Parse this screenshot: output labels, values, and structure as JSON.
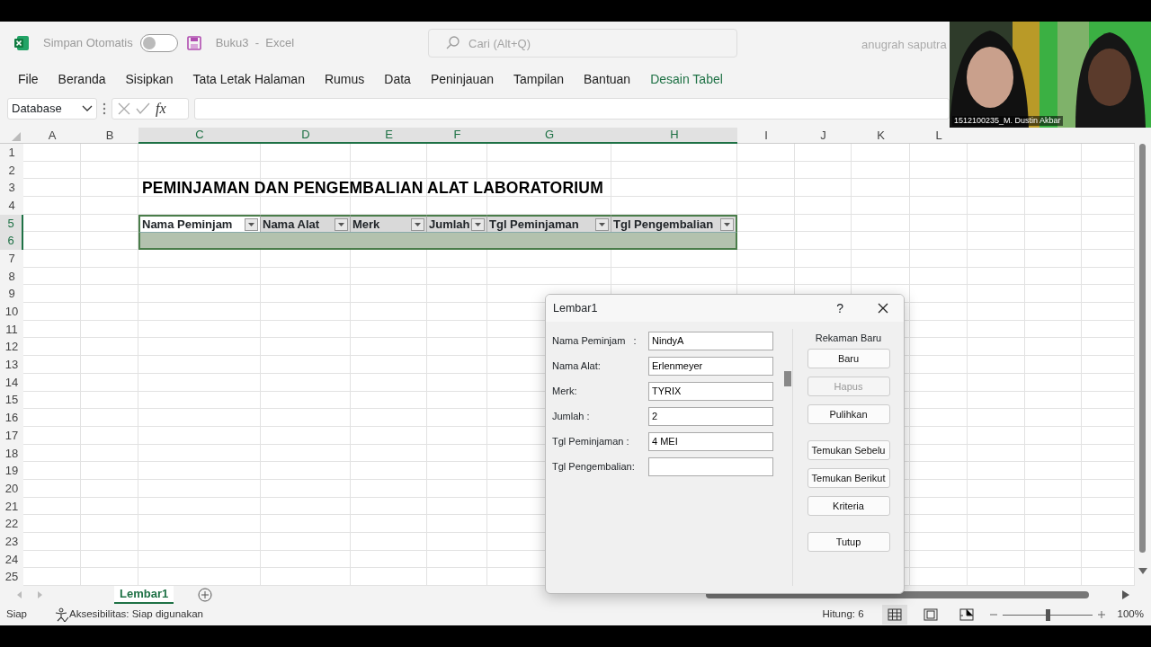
{
  "titlebar": {
    "autosave_label": "Simpan Otomatis",
    "autosave_on": false,
    "document": "Buku3",
    "separator": "-",
    "app": "Excel",
    "search": {
      "placeholder": "Cari (Alt+Q)"
    },
    "user": "anugrah saputra"
  },
  "ribbon_tabs": [
    {
      "label": "File",
      "kind": "standard"
    },
    {
      "label": "Beranda",
      "kind": "standard"
    },
    {
      "label": "Sisipkan",
      "kind": "standard"
    },
    {
      "label": "Tata Letak Halaman",
      "kind": "standard"
    },
    {
      "label": "Rumus",
      "kind": "standard"
    },
    {
      "label": "Data",
      "kind": "standard"
    },
    {
      "label": "Peninjauan",
      "kind": "standard"
    },
    {
      "label": "Tampilan",
      "kind": "standard"
    },
    {
      "label": "Bantuan",
      "kind": "standard"
    },
    {
      "label": "Desain Tabel",
      "kind": "contextual"
    }
  ],
  "formula_bar": {
    "name_box": "Database",
    "function_label": "fx"
  },
  "sheet": {
    "columns": [
      {
        "label": "A",
        "selected": false
      },
      {
        "label": "B",
        "selected": false
      },
      {
        "label": "C",
        "selected": true
      },
      {
        "label": "D",
        "selected": true
      },
      {
        "label": "E",
        "selected": true
      },
      {
        "label": "F",
        "selected": true
      },
      {
        "label": "G",
        "selected": true
      },
      {
        "label": "H",
        "selected": true
      },
      {
        "label": "I",
        "selected": false
      },
      {
        "label": "J",
        "selected": false
      },
      {
        "label": "K",
        "selected": false
      },
      {
        "label": "L",
        "selected": false
      }
    ],
    "rows": [
      {
        "label": "1",
        "selected": false
      },
      {
        "label": "2",
        "selected": false
      },
      {
        "label": "3",
        "selected": false
      },
      {
        "label": "4",
        "selected": false
      },
      {
        "label": "5",
        "selected": true
      },
      {
        "label": "6",
        "selected": true
      },
      {
        "label": "7",
        "selected": false
      },
      {
        "label": "8",
        "selected": false
      },
      {
        "label": "9",
        "selected": false
      },
      {
        "label": "10",
        "selected": false
      },
      {
        "label": "11",
        "selected": false
      },
      {
        "label": "12",
        "selected": false
      },
      {
        "label": "13",
        "selected": false
      },
      {
        "label": "14",
        "selected": false
      },
      {
        "label": "15",
        "selected": false
      },
      {
        "label": "16",
        "selected": false
      },
      {
        "label": "17",
        "selected": false
      },
      {
        "label": "18",
        "selected": false
      },
      {
        "label": "19",
        "selected": false
      },
      {
        "label": "20",
        "selected": false
      },
      {
        "label": "21",
        "selected": false
      },
      {
        "label": "22",
        "selected": false
      },
      {
        "label": "23",
        "selected": false
      },
      {
        "label": "24",
        "selected": false
      },
      {
        "label": "25",
        "selected": false
      }
    ],
    "title": "PEMINJAMAN DAN PENGEMBALIAN ALAT LABORATORIUM",
    "table": {
      "headers": [
        "Nama Peminjam",
        "Nama Alat",
        "Merk",
        "Jumlah",
        "Tgl Peminjaman",
        "Tgl Pengembalian"
      ]
    }
  },
  "video": {
    "caption": "1512100235_M. Dustin Akbar"
  },
  "dialog": {
    "title": "Lembar1",
    "help": "?",
    "fields": [
      {
        "label": "Nama Peminjam   :",
        "value": "NindyA"
      },
      {
        "label": "Nama Alat:",
        "value": "Erlenmeyer"
      },
      {
        "label": "Merk:",
        "value": "TYRIX"
      },
      {
        "label": "Jumlah :",
        "value": "2"
      },
      {
        "label": "Tgl Peminjaman :",
        "value": "4 MEI"
      },
      {
        "label": "Tgl Pengembalian:"
      }
    ],
    "record_status": "Rekaman Baru",
    "buttons": [
      {
        "label": "Baru",
        "disabled": false
      },
      {
        "label": "Hapus",
        "disabled": true
      },
      {
        "label": "Pulihkan",
        "disabled": false
      },
      {
        "label": "Temukan Sebelu",
        "disabled": false
      },
      {
        "label": "Temukan Berikut",
        "disabled": false
      },
      {
        "label": "Kriteria",
        "disabled": false
      },
      {
        "label": "Tutup",
        "disabled": false
      }
    ]
  },
  "sheet_tabs": [
    {
      "label": "Lembar1",
      "selected": true
    }
  ],
  "status_bar": {
    "mode": "Siap",
    "accessibility": "Aksesibilitas: Siap digunakan",
    "count": "Hitung: 6",
    "views": [
      {
        "kind": "normal",
        "selected": true
      },
      {
        "kind": "page_layout",
        "selected": false
      },
      {
        "kind": "page_break",
        "selected": false
      }
    ],
    "zoom": {
      "level": 0.5,
      "reading": "100%"
    }
  }
}
